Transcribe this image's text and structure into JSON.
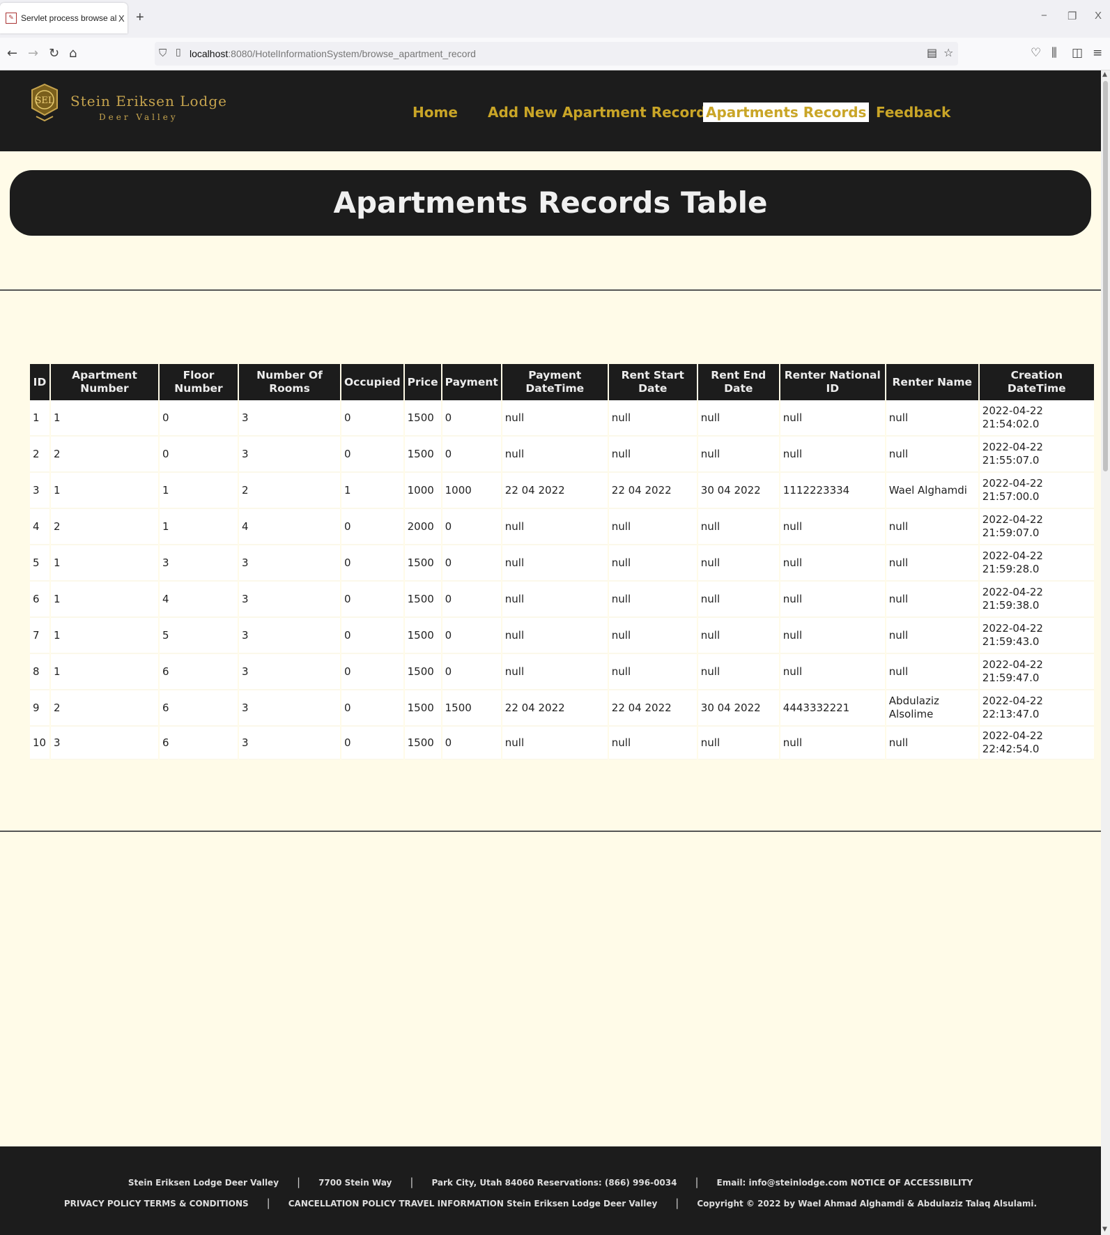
{
  "browser": {
    "tab_title": "Servlet process browse all apart",
    "tab_close": "X",
    "new_tab": "+",
    "url_host": "localhost",
    "url_rest": ":8080/HotelInformationSystem/browse_apartment_record",
    "minimize": "−",
    "restore": "❐",
    "close": "X"
  },
  "site": {
    "logo_line1": "Stein Eriksen Lodge",
    "logo_line2": "Deer Valley",
    "nav": {
      "home": "Home",
      "add": "Add New Apartment Record",
      "records": "Apartments Records",
      "feedback": "Feedback"
    },
    "page_title": "Apartments Records Table"
  },
  "table": {
    "headers": {
      "id": "ID",
      "apt": "Apartment Number",
      "floor": "Floor Number",
      "rooms": "Number Of Rooms",
      "occupied": "Occupied",
      "price": "Price",
      "payment": "Payment",
      "paydt": "Payment DateTime",
      "start": "Rent Start Date",
      "end": "Rent End Date",
      "nid": "Renter National ID",
      "name": "Renter Name",
      "created": "Creation DateTime"
    },
    "rows": [
      {
        "id": "1",
        "apt": "1",
        "floor": "0",
        "rooms": "3",
        "occupied": "0",
        "price": "1500",
        "payment": "0",
        "paydt": "null",
        "start": "null",
        "end": "null",
        "nid": "null",
        "name": "null",
        "created_date": "2022-04-22",
        "created_time": "21:54:02.0"
      },
      {
        "id": "2",
        "apt": "2",
        "floor": "0",
        "rooms": "3",
        "occupied": "0",
        "price": "1500",
        "payment": "0",
        "paydt": "null",
        "start": "null",
        "end": "null",
        "nid": "null",
        "name": "null",
        "created_date": "2022-04-22",
        "created_time": "21:55:07.0"
      },
      {
        "id": "3",
        "apt": "1",
        "floor": "1",
        "rooms": "2",
        "occupied": "1",
        "price": "1000",
        "payment": "1000",
        "paydt": "22 04 2022",
        "start": "22 04 2022",
        "end": "30 04 2022",
        "nid": "1112223334",
        "name": "Wael Alghamdi",
        "created_date": "2022-04-22",
        "created_time": "21:57:00.0"
      },
      {
        "id": "4",
        "apt": "2",
        "floor": "1",
        "rooms": "4",
        "occupied": "0",
        "price": "2000",
        "payment": "0",
        "paydt": "null",
        "start": "null",
        "end": "null",
        "nid": "null",
        "name": "null",
        "created_date": "2022-04-22",
        "created_time": "21:59:07.0"
      },
      {
        "id": "5",
        "apt": "1",
        "floor": "3",
        "rooms": "3",
        "occupied": "0",
        "price": "1500",
        "payment": "0",
        "paydt": "null",
        "start": "null",
        "end": "null",
        "nid": "null",
        "name": "null",
        "created_date": "2022-04-22",
        "created_time": "21:59:28.0"
      },
      {
        "id": "6",
        "apt": "1",
        "floor": "4",
        "rooms": "3",
        "occupied": "0",
        "price": "1500",
        "payment": "0",
        "paydt": "null",
        "start": "null",
        "end": "null",
        "nid": "null",
        "name": "null",
        "created_date": "2022-04-22",
        "created_time": "21:59:38.0"
      },
      {
        "id": "7",
        "apt": "1",
        "floor": "5",
        "rooms": "3",
        "occupied": "0",
        "price": "1500",
        "payment": "0",
        "paydt": "null",
        "start": "null",
        "end": "null",
        "nid": "null",
        "name": "null",
        "created_date": "2022-04-22",
        "created_time": "21:59:43.0"
      },
      {
        "id": "8",
        "apt": "1",
        "floor": "6",
        "rooms": "3",
        "occupied": "0",
        "price": "1500",
        "payment": "0",
        "paydt": "null",
        "start": "null",
        "end": "null",
        "nid": "null",
        "name": "null",
        "created_date": "2022-04-22",
        "created_time": "21:59:47.0"
      },
      {
        "id": "9",
        "apt": "2",
        "floor": "6",
        "rooms": "3",
        "occupied": "0",
        "price": "1500",
        "payment": "1500",
        "paydt": "22 04 2022",
        "start": "22 04 2022",
        "end": "30 04 2022",
        "nid": "4443332221",
        "name": "Abdulaziz Alsolime",
        "created_date": "2022-04-22",
        "created_time": "22:13:47.0"
      },
      {
        "id": "10",
        "apt": "3",
        "floor": "6",
        "rooms": "3",
        "occupied": "0",
        "price": "1500",
        "payment": "0",
        "paydt": "null",
        "start": "null",
        "end": "null",
        "nid": "null",
        "name": "null",
        "created_date": "2022-04-22",
        "created_time": "22:42:54.0"
      }
    ]
  },
  "footer": {
    "row1": [
      "Stein Eriksen Lodge Deer Valley",
      "7700 Stein Way",
      "Park City, Utah 84060 Reservations: (866) 996-0034",
      "Email: info@steinlodge.com NOTICE OF ACCESSIBILITY"
    ],
    "row2": [
      "PRIVACY POLICY TERMS & CONDITIONS",
      "CANCELLATION POLICY TRAVEL INFORMATION Stein Eriksen Lodge Deer Valley",
      "Copyright © 2022 by Wael Ahmad Alghamdi & Abdulaziz Talaq Alsulami."
    ],
    "separator": "|"
  },
  "colors": {
    "header_bg": "#1c1c1c",
    "nav_gold": "#c9a527",
    "page_bg": "#fffbe8"
  }
}
